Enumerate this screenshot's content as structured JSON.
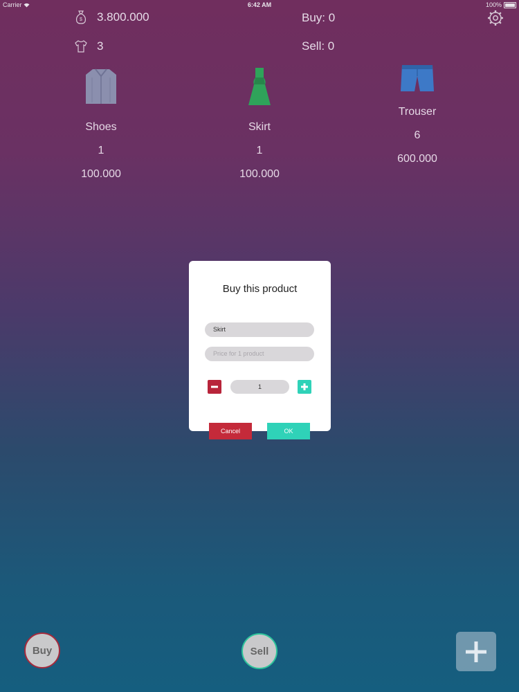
{
  "status_bar": {
    "carrier": "Carrier",
    "time": "6:42 AM",
    "battery": "100%"
  },
  "stats": {
    "money": "3.800.000",
    "items": "3",
    "buy": "Buy: 0",
    "sell": "Sell: 0"
  },
  "products": [
    {
      "name": "Shoes",
      "count": "1",
      "price": "100.000",
      "icon": "shirt-icon",
      "color": "#8b8fae"
    },
    {
      "name": "Skirt",
      "count": "1",
      "price": "100.000",
      "icon": "dress-icon",
      "color": "#2fa35a"
    },
    {
      "name": "Trouser",
      "count": "6",
      "price": "600.000",
      "icon": "shorts-icon",
      "color": "#3d79c7"
    }
  ],
  "dialog": {
    "title": "Buy this product",
    "product_value": "Skirt",
    "price_placeholder": "Price for 1 product",
    "quantity": "1",
    "cancel_label": "Cancel",
    "ok_label": "OK"
  },
  "bottom_bar": {
    "buy_label": "Buy",
    "sell_label": "Sell"
  },
  "colors": {
    "cancel": "#c42a3a",
    "ok": "#2fd2b8",
    "minus": "#b8243a",
    "plus": "#2fd2b8"
  }
}
